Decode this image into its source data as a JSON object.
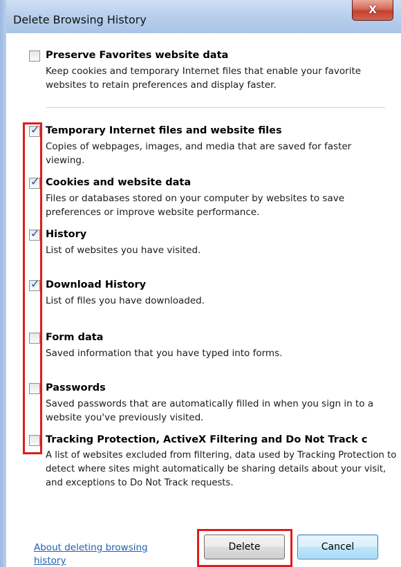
{
  "window": {
    "title": "Delete Browsing History",
    "close_symbol": "X"
  },
  "options": [
    {
      "title": "Preserve Favorites website data",
      "description": "Keep cookies and temporary Internet files that enable your favorite websites to retain preferences and display faster.",
      "checked": false
    },
    {
      "title": "Temporary Internet files and website files",
      "description": "Copies of webpages, images, and media that are saved for faster viewing.",
      "checked": true
    },
    {
      "title": "Cookies and website data",
      "description": "Files or databases stored on your computer by websites to save preferences or improve website performance.",
      "checked": true
    },
    {
      "title": "History",
      "description": "List of websites you have visited.",
      "checked": true
    },
    {
      "title": "Download History",
      "description": "List of files you have downloaded.",
      "checked": true
    },
    {
      "title": "Form data",
      "description": "Saved information that you have typed into forms.",
      "checked": false
    },
    {
      "title": "Passwords",
      "description": "Saved passwords that are automatically filled in when you sign in to a website you've previously visited.",
      "checked": false
    },
    {
      "title": "Tracking Protection, ActiveX Filtering and Do Not Track c",
      "description": "A list of websites excluded from filtering, data used by Tracking Protection to detect where sites might automatically be sharing details about your visit, and exceptions to Do Not Track requests.",
      "checked": false
    }
  ],
  "footer": {
    "about_link": "About deleting browsing history",
    "delete_label": "Delete",
    "cancel_label": "Cancel"
  },
  "colors": {
    "highlight": "#e01b1b",
    "check": "#2a4fa8",
    "link": "#1f5fb0"
  },
  "icons": {
    "checkmark": "check-icon",
    "close": "close-icon"
  }
}
